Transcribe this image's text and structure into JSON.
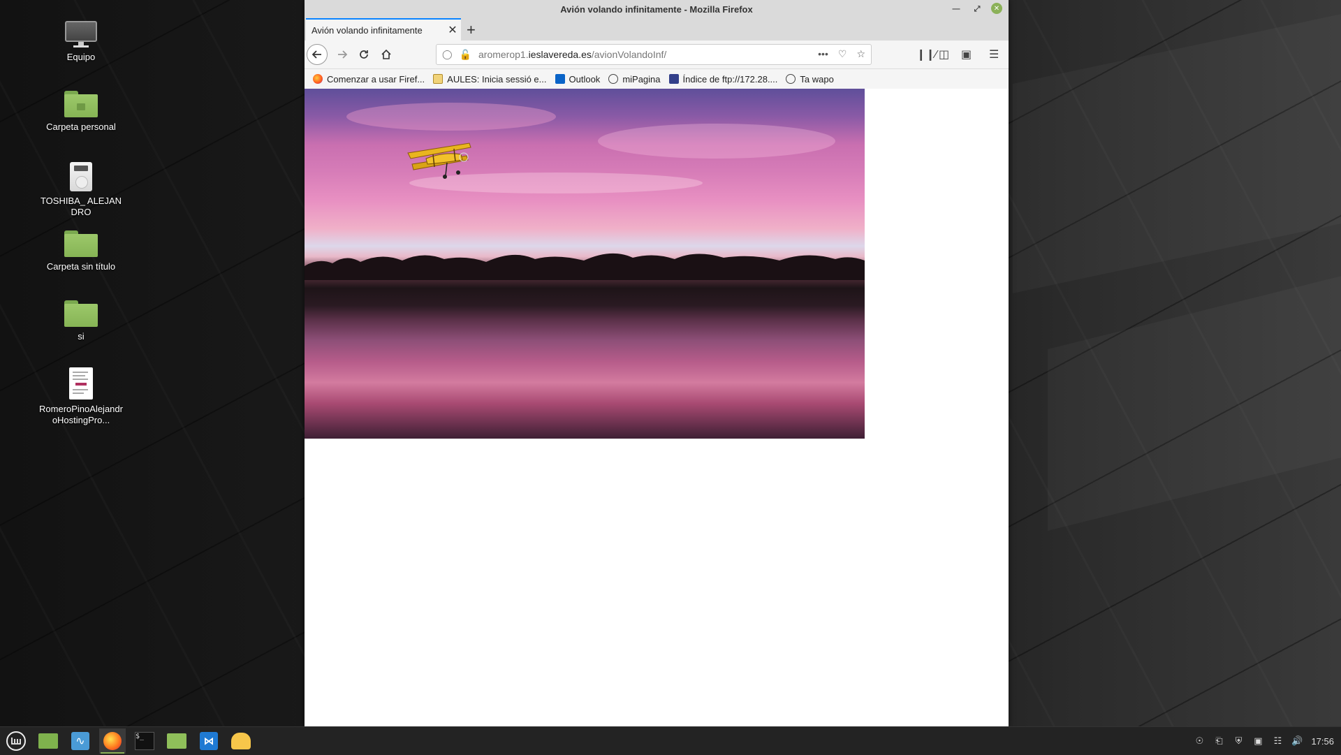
{
  "window": {
    "title": "Avión volando infinitamente - Mozilla Firefox"
  },
  "desktop": {
    "icons": [
      {
        "label": "Equipo",
        "icon": "computer-icon"
      },
      {
        "label": "Carpeta personal",
        "icon": "home-folder-icon"
      },
      {
        "label": "TOSHIBA_ ALEJANDRO",
        "icon": "usb-drive-icon"
      },
      {
        "label": "Carpeta sin título",
        "icon": "folder-icon"
      },
      {
        "label": "si",
        "icon": "folder-icon"
      },
      {
        "label": "RomeroPinoAlejandroHostingPro...",
        "icon": "document-icon"
      }
    ]
  },
  "browser": {
    "tab": {
      "title": "Avión volando infinitamente",
      "close": "✕"
    },
    "new_tab": "+",
    "url": {
      "prefix": "aromerop1.",
      "host": "ieslavereda.es",
      "path": "/avionVolandoInf/"
    },
    "bookmarks": [
      {
        "label": "Comenzar a usar Firef...",
        "icon": "firefox-icon"
      },
      {
        "label": "AULES: Inicia sessió e...",
        "icon": "aules-icon"
      },
      {
        "label": "Outlook",
        "icon": "outlook-icon"
      },
      {
        "label": "miPagina",
        "icon": "globe-icon"
      },
      {
        "label": "Índice de ftp://172.28....",
        "icon": "ftp-icon"
      },
      {
        "label": "Ta wapo",
        "icon": "globe-icon"
      }
    ]
  },
  "page": {
    "image": "sunset-lake-with-flying-biplane"
  },
  "taskbar": {
    "clock": "17:56",
    "apps": [
      "menu-icon",
      "files-icon",
      "system-monitor-icon",
      "firefox-icon",
      "terminal-icon",
      "folder-icon",
      "vscode-icon",
      "filezilla-icon"
    ],
    "tray": [
      "redshift-icon",
      "clipboard-icon",
      "shield-icon",
      "updates-icon",
      "network-icon",
      "volume-icon"
    ]
  },
  "colors": {
    "accent": "#8bb158",
    "tab_highlight": "#0a84ff",
    "taskbar": "#232323"
  }
}
